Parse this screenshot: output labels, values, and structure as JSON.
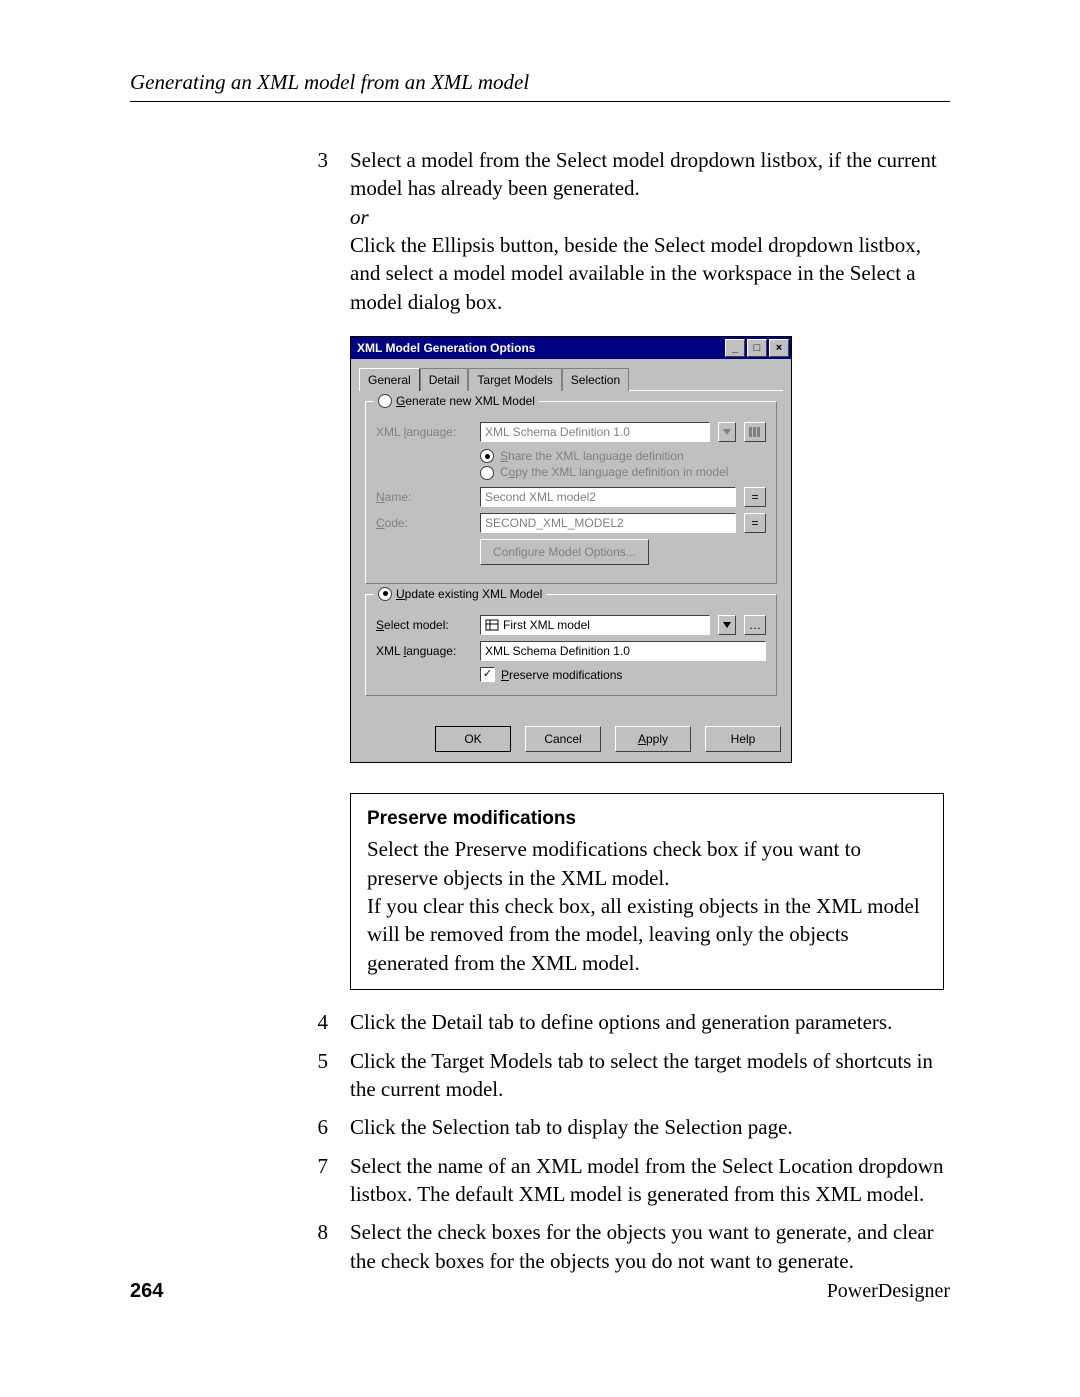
{
  "header": {
    "title": "Generating an XML model from an XML model"
  },
  "steps": {
    "s3": {
      "num": "3",
      "p1": "Select a model from the Select model dropdown listbox, if the current model has already been generated.",
      "or": "or",
      "p2": "Click the Ellipsis button, beside the Select model dropdown listbox, and select a model model available in the workspace in the Select a model dialog box."
    },
    "s4": {
      "num": "4",
      "txt": "Click the Detail tab to define options and generation parameters."
    },
    "s5": {
      "num": "5",
      "txt": "Click the Target Models tab to select the target models of shortcuts in the current model."
    },
    "s6": {
      "num": "6",
      "txt": "Click the Selection tab to display the Selection page."
    },
    "s7": {
      "num": "7",
      "txt": "Select the name of an XML model from the Select Location dropdown listbox. The default XML model is generated from this XML model."
    },
    "s8": {
      "num": "8",
      "txt": "Select the check boxes for the objects you want to generate, and clear the check boxes for the objects you do not want to generate."
    }
  },
  "dialog": {
    "title": "XML Model Generation Options",
    "tabs": {
      "general": "General",
      "detail": "Detail",
      "target": "Target Models",
      "selection": "Selection"
    },
    "group1": {
      "legend_g": "G",
      "legend_rest": "enerate new XML Model",
      "xml_lang_label_pre": "XML ",
      "xml_lang_label_u": "l",
      "xml_lang_label_post": "anguage:",
      "xml_lang_value": "XML Schema Definition 1.0",
      "share_pre": "",
      "share_u": "S",
      "share_post": "hare the XML language definition",
      "copy_pre": "C",
      "copy_u": "o",
      "copy_post": "py the XML language definition in model",
      "name_u": "N",
      "name_post": "ame:",
      "name_value": "Second XML model2",
      "code_u": "C",
      "code_post": "ode:",
      "code_value": "SECOND_XML_MODEL2",
      "configure": "Configure Model Options..."
    },
    "group2": {
      "legend_u": "U",
      "legend_post": "pdate existing XML Model",
      "select_u": "S",
      "select_post": "elect model:",
      "select_value": "First XML model",
      "xml_lang_label_pre": "XML ",
      "xml_lang_label_u": "l",
      "xml_lang_label_post": "anguage:",
      "lang_value": "XML Schema Definition 1.0",
      "preserve_u": "P",
      "preserve_post": "reserve modifications"
    },
    "buttons": {
      "ok": "OK",
      "cancel": "Cancel",
      "apply_u": "A",
      "apply_post": "pply",
      "help": "Help"
    },
    "winbtns": {
      "min": "_",
      "max": "□",
      "close": "×"
    }
  },
  "note": {
    "title": "Preserve modifications",
    "p1": "Select the Preserve modifications check box if you want to preserve objects in the XML model.",
    "p2": "If you clear this check box, all existing objects in the XML model will be removed from the model, leaving only the objects generated from the XML model."
  },
  "footer": {
    "page": "264",
    "product": "PowerDesigner"
  }
}
